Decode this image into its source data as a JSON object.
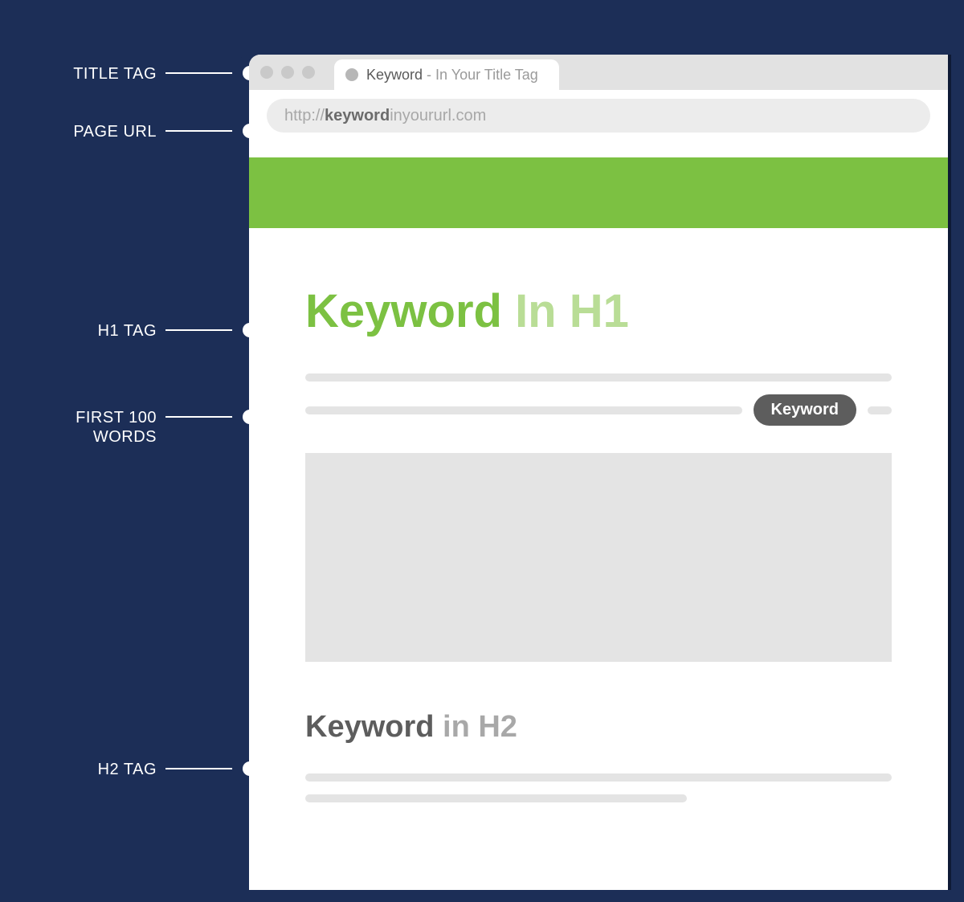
{
  "labels": {
    "title_tag": "TITLE TAG",
    "page_url": "PAGE URL",
    "h1_tag": "H1 TAG",
    "first_100_a": "FIRST 100",
    "first_100_b": "WORDS",
    "h2_tag": "H2 TAG"
  },
  "tab": {
    "strong": "Keyword",
    "rest": " - In Your Title Tag"
  },
  "url": {
    "prefix": "http://",
    "strong": "keyword",
    "rest": "inyoururl.com"
  },
  "h1": {
    "strong": "Keyword",
    "rest": " In H1"
  },
  "pill": "Keyword",
  "h2": {
    "strong": "Keyword",
    "rest": " in H2"
  },
  "colors": {
    "bg": "#1c2e57",
    "green": "#7cc142",
    "green_light": "#b9dd96",
    "gray": "#e4e4e4",
    "pill": "#5d5d5d"
  }
}
